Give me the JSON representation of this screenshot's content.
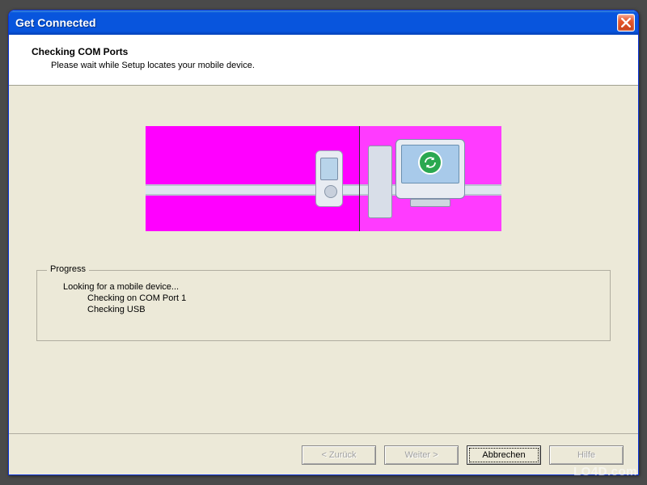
{
  "window": {
    "title": "Get Connected"
  },
  "header": {
    "title": "Checking COM Ports",
    "subtitle": "Please wait while Setup locates your mobile device."
  },
  "banner": {
    "phone_icon": "mobile-phone",
    "monitor_icon": "desktop-monitor",
    "sync_icon": "sync-arrows",
    "cable": "usb-cable",
    "bg_color_left": "#ff00ff",
    "bg_color_right": "#ff3bff"
  },
  "progress": {
    "legend": "Progress",
    "status": "Looking for a mobile device...",
    "steps": [
      "Checking on COM Port 1",
      "Checking USB"
    ]
  },
  "buttons": {
    "back": "< Zurück",
    "next": "Weiter >",
    "cancel": "Abbrechen",
    "help": "Hilfe"
  },
  "watermark": "LO4D.com"
}
